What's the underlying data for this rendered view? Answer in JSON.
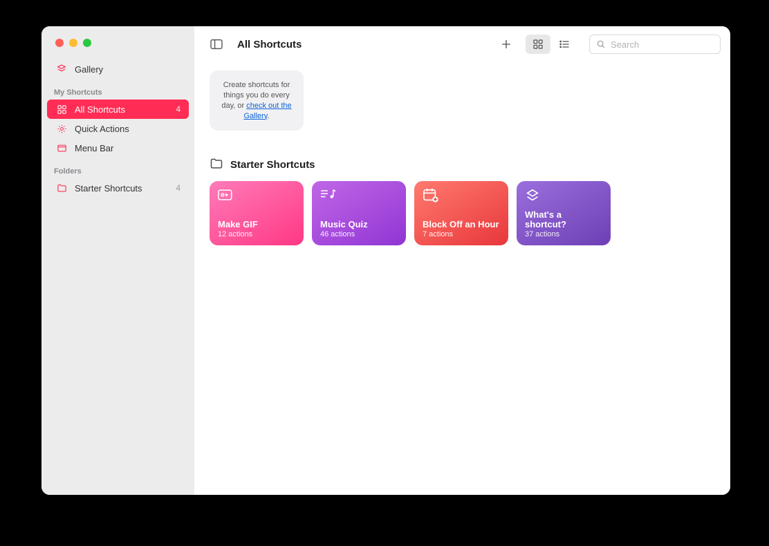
{
  "header": {
    "title": "All Shortcuts",
    "search_placeholder": "Search"
  },
  "sidebar": {
    "gallery_label": "Gallery",
    "section1": "My Shortcuts",
    "items": [
      {
        "label": "All Shortcuts",
        "count": "4"
      },
      {
        "label": "Quick Actions"
      },
      {
        "label": "Menu Bar"
      }
    ],
    "section2": "Folders",
    "folders": [
      {
        "label": "Starter Shortcuts",
        "count": "4"
      }
    ]
  },
  "tip": {
    "line1": "Create shortcuts for things you do every day, or ",
    "link": "check out the Gallery",
    "tail": "."
  },
  "section_title": "Starter Shortcuts",
  "shortcuts": [
    {
      "title": "Make GIF",
      "sub": "12 actions",
      "grad": "grad-pink"
    },
    {
      "title": "Music Quiz",
      "sub": "46 actions",
      "grad": "grad-purple"
    },
    {
      "title": "Block Off an Hour",
      "sub": "7 actions",
      "grad": "grad-red"
    },
    {
      "title": "What's a shortcut?",
      "sub": "37 actions",
      "grad": "grad-violet"
    }
  ]
}
